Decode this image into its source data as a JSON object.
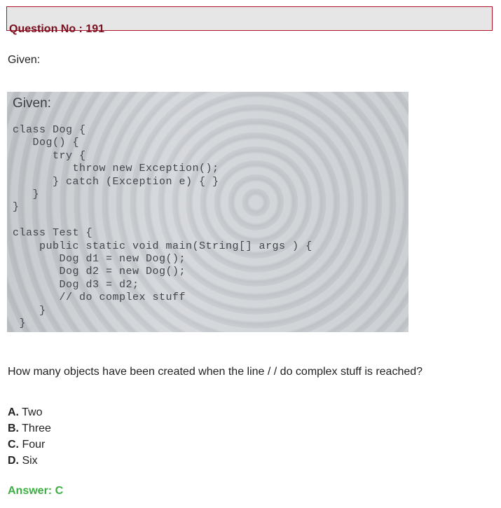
{
  "question": {
    "number_label": "Question No : 191"
  },
  "given_label": "Given:",
  "code_image": {
    "caption": "Given:",
    "code": "class Dog {\n   Dog() {\n      try {\n         throw new Exception();\n      } catch (Exception e) { }\n   }\n}\n\nclass Test {\n    public static void main(String[] args ) {\n       Dog d1 = new Dog();\n       Dog d2 = new Dog();\n       Dog d3 = d2;\n       // do complex stuff\n    }\n }"
  },
  "prompt": "How many objects have been created when the line / / do complex stuff is reached?",
  "options": [
    {
      "letter": "A.",
      "text": " Two"
    },
    {
      "letter": "B.",
      "text": " Three"
    },
    {
      "letter": "C.",
      "text": " Four"
    },
    {
      "letter": "D.",
      "text": " Six"
    }
  ],
  "answer": "Answer: C",
  "colors": {
    "header_border": "#b0142a",
    "header_bg": "#e6e6e6",
    "title_text": "#7a1020",
    "answer_text": "#3cb043"
  }
}
